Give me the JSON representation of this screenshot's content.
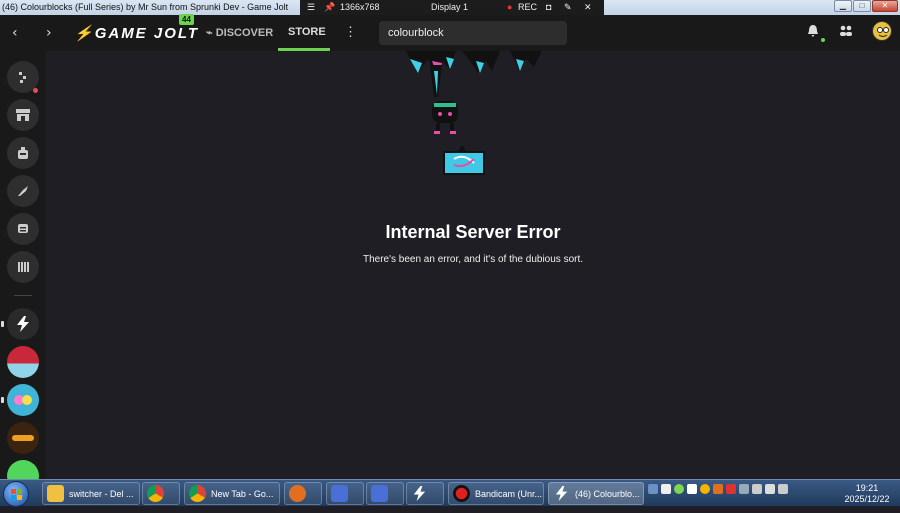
{
  "window": {
    "title": "(46) Colourblocks (Full Series) by Mr Sun from Sprunki Dev - Game Jolt",
    "controls": [
      "minimize",
      "maximize",
      "close"
    ]
  },
  "recorder": {
    "resolution": "1366x768",
    "display": "Display 1",
    "rec_label": "REC"
  },
  "nav": {
    "logo": "GAME JOLT",
    "badge": "44",
    "discover": "DISCOVER",
    "store": "STORE",
    "search_value": "colourblock",
    "accent": "#6bd34d"
  },
  "sidebar": {
    "items": [
      "activity-icon",
      "shop-icon",
      "backpack-icon",
      "quests-icon",
      "chat-icon",
      "library-icon",
      "gamejolt-community",
      "community-2",
      "community-3",
      "community-4",
      "community-5"
    ]
  },
  "main": {
    "error_title": "Internal Server Error",
    "error_message": "There's been an error, and it's of the dubious sort."
  },
  "taskbar": {
    "items": [
      {
        "label": "switcher - Del ..."
      },
      {
        "label": ""
      },
      {
        "label": "New Tab - Go..."
      },
      {
        "label": ""
      },
      {
        "label": ""
      },
      {
        "label": ""
      },
      {
        "label": ""
      },
      {
        "label": "Bandicam (Unr..."
      },
      {
        "label": "(46) Colourblo..."
      }
    ],
    "clock_time": "19:21",
    "clock_date": "2025/12/22"
  }
}
